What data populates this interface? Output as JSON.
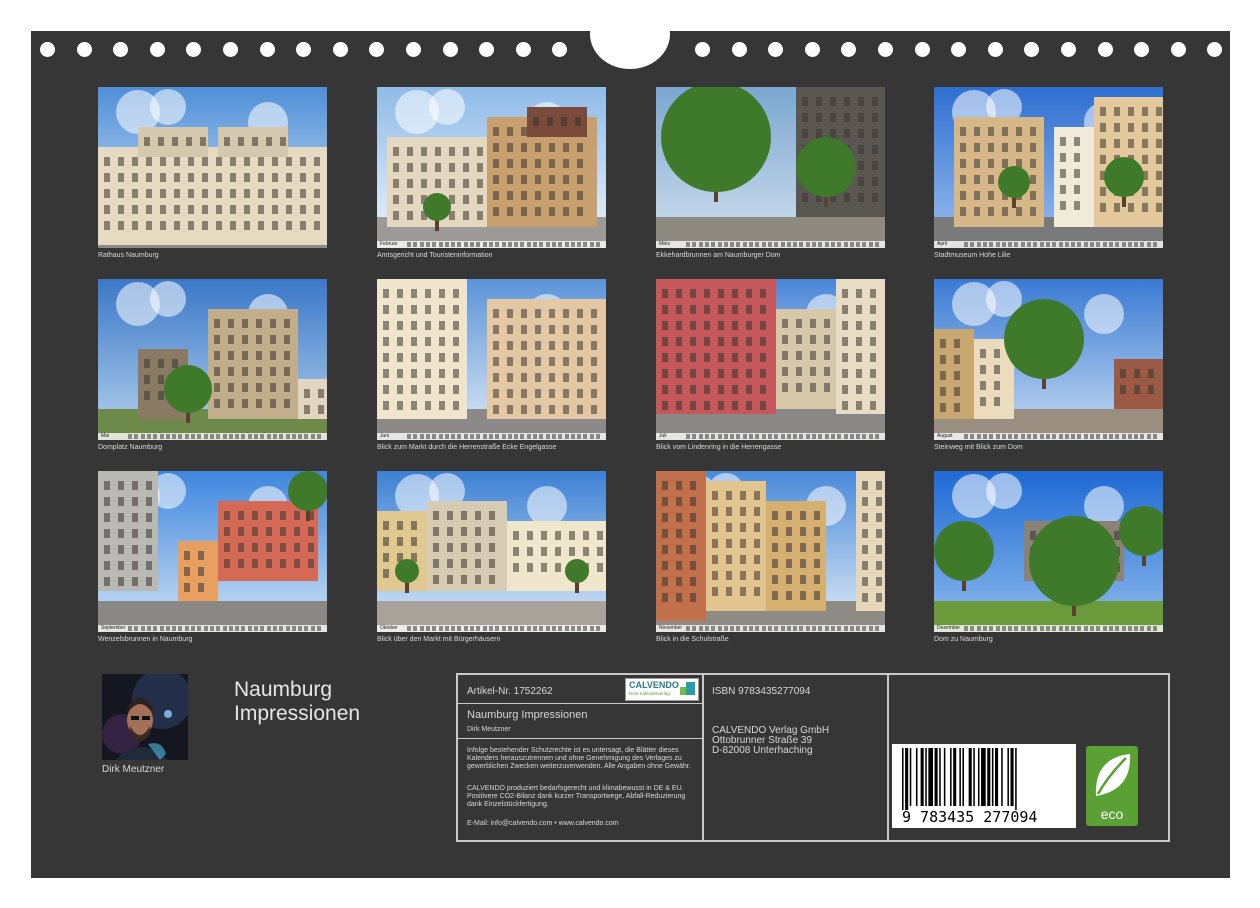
{
  "photos": [
    {
      "caption": "Rathaus Naumburg",
      "month": ""
    },
    {
      "caption": "Amtsgericht und Touristeninformation",
      "month": "Februar"
    },
    {
      "caption": "Ekkehardbrunnen am Naumburger Dom",
      "month": "März"
    },
    {
      "caption": "Stadtmuseum Hohe Lilie",
      "month": "April"
    },
    {
      "caption": "Domplatz Naumburg",
      "month": "Mai"
    },
    {
      "caption": "Blick zum Markt durch die Herrenstraße Ecke Engelgasse",
      "month": "Juni"
    },
    {
      "caption": "Blick vom Lindenring in die Herrengasse",
      "month": "Juli"
    },
    {
      "caption": "Steinweg mit Blick zum Dom",
      "month": "August"
    },
    {
      "caption": "Wenzelsbrunnen in Naumburg",
      "month": "September"
    },
    {
      "caption": "Blick über den Markt mit Bürgerhäusern",
      "month": "Oktober"
    },
    {
      "caption": "Blick in die Schulstraße",
      "month": "November"
    },
    {
      "caption": "Dom zu Naumburg",
      "month": "Dezember"
    }
  ],
  "author": {
    "name": "Dirk Meutzner"
  },
  "calendar": {
    "title_line1": "Naumburg",
    "title_line2": "Impressionen"
  },
  "info": {
    "article": "Artikel-Nr. 1752262",
    "logo_text": "CALVENDO",
    "logo_sub": "Dein Kalenderverlag",
    "title": "Naumburg Impressionen",
    "author": "Dirk Meutzner",
    "legal": "Infolge bestehender Schutzrechte ist es untersagt, die Blätter dieses Kalenders herauszutrennen und ohne Genehmigung des Verlages zu gewerblichen Zwecken weiterzuverwenden. Alle Angaben ohne Gewähr.",
    "eco_text": "CALVENDO produziert bedarfsgerecht und klimabewusst in DE & EU. Positivere CO2-Bilanz dank kurzer Transportwege, Abfall-Reduzierung dank Einzelstückfertigung.",
    "contact": "E-Mail: info@calvendo.com • www.calvendo.com",
    "isbn": "ISBN 9783435277094",
    "publisher_name": "CALVENDO Verlag GmbH",
    "publisher_street": "Ottobrunner Straße 39",
    "publisher_city": "D-82008 Unterhaching",
    "barcode_digits": "9 783435 277094",
    "eco_label": "eco"
  },
  "colors": {
    "background": "#363636",
    "text": "#d8d8d8",
    "border": "#c9c9c9",
    "eco": "#5aa032"
  }
}
